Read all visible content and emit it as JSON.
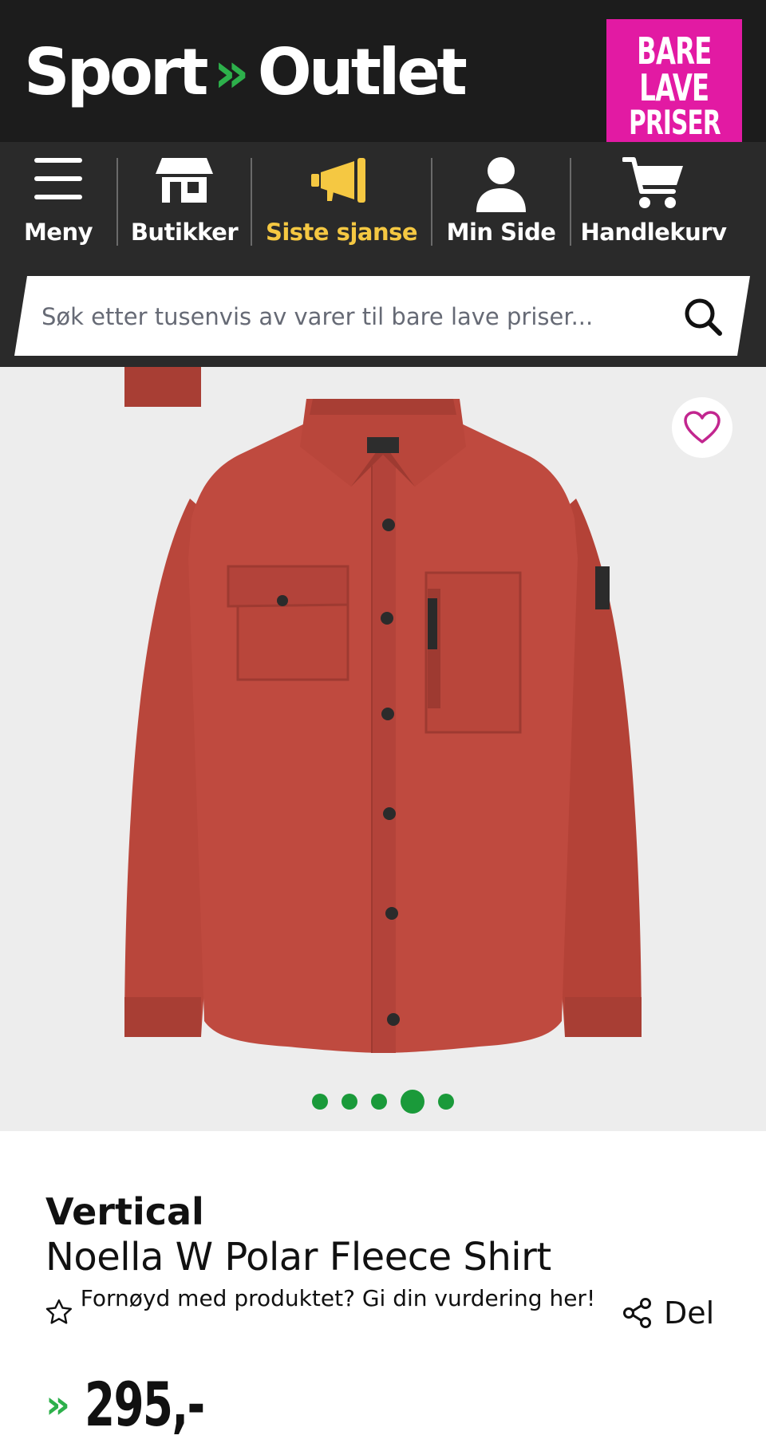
{
  "header": {
    "logo_left": "Sport",
    "logo_arrows": "»",
    "logo_right": "Outlet",
    "badge": [
      "BARE",
      "LAVE",
      "PRISER"
    ]
  },
  "nav": {
    "items": [
      {
        "label": "Meny",
        "icon": "menu-icon"
      },
      {
        "label": "Butikker",
        "icon": "store-icon"
      },
      {
        "label": "Siste sjanse",
        "icon": "megaphone-icon",
        "active": true
      },
      {
        "label": "Min Side",
        "icon": "user-icon"
      },
      {
        "label": "Handlekurv",
        "icon": "cart-icon"
      }
    ],
    "active_color": "#f5c842"
  },
  "search": {
    "placeholder": "Søk etter tusenvis av varer til bare lave priser...",
    "value": ""
  },
  "gallery": {
    "favorite_icon": "heart-icon",
    "image_count": 5,
    "active_index": 3
  },
  "product": {
    "brand": "Vertical",
    "title": "Noella W Polar Fleece Shirt",
    "rating_prompt": "Fornøyd med produktet? Gi din vurdering her!",
    "share_label": "Del",
    "price_arrows": "»",
    "price": "295,-"
  },
  "colors": {
    "header_bg": "#1c1c1c",
    "nav_bg": "#2a2a2a",
    "brand_green": "#2db04b",
    "badge_pink": "#e21aa3",
    "dot_green": "#1a9a3a",
    "product_red": "#b9463b"
  }
}
